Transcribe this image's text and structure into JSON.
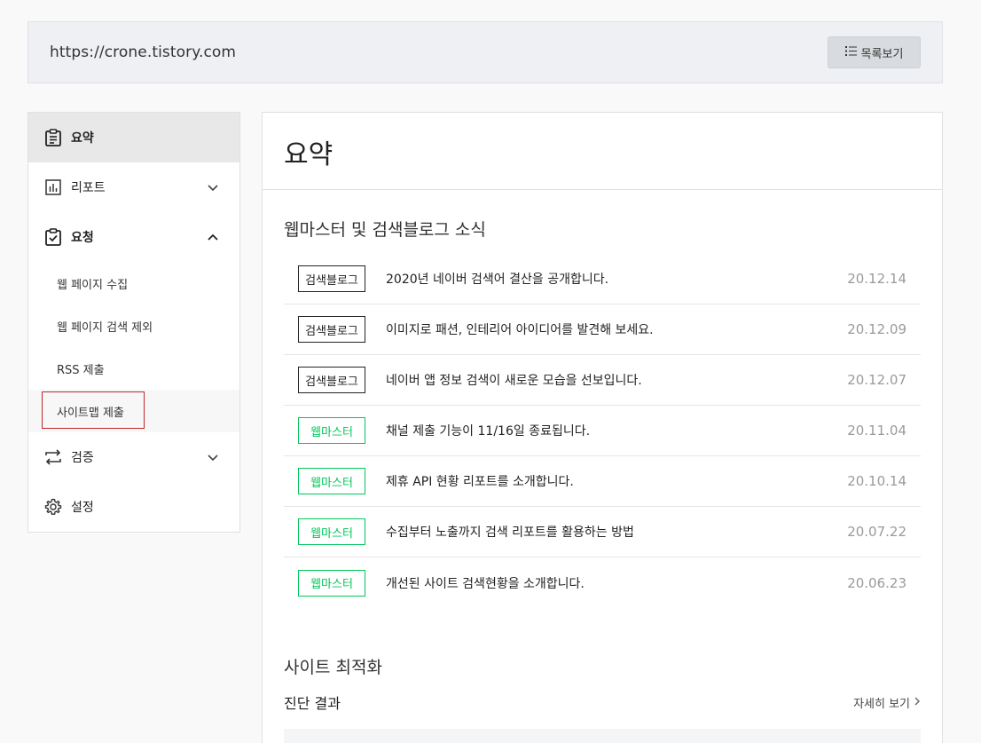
{
  "url_bar": {
    "url": "https://crone.tistory.com",
    "list_button_label": "목록보기"
  },
  "sidebar": {
    "items": [
      {
        "label": "요약",
        "icon": "clipboard-icon",
        "active": true
      },
      {
        "label": "리포트",
        "icon": "bar-chart-icon",
        "chevron": "down"
      },
      {
        "label": "요청",
        "icon": "check-clipboard-icon",
        "chevron": "up"
      }
    ],
    "sub_items": [
      "웹 페이지 수집",
      "웹 페이지 검색 제외",
      "RSS 제출",
      "사이트맵 제출"
    ],
    "bottom_items": [
      {
        "label": "검증",
        "icon": "swap-arrows-icon",
        "chevron": "down"
      },
      {
        "label": "설정",
        "icon": "gear-icon"
      }
    ]
  },
  "main": {
    "title": "요약",
    "news_section_title": "웹마스터 및 검색블로그 소식",
    "news": [
      {
        "tag": "검색블로그",
        "title": "2020년 네이버 검색어 결산을 공개합니다.",
        "date": "20.12.14"
      },
      {
        "tag": "검색블로그",
        "title": "이미지로 패션, 인테리어 아이디어를 발견해 보세요.",
        "date": "20.12.09"
      },
      {
        "tag": "검색블로그",
        "title": "네이버 앱 정보 검색이 새로운 모습을 선보입니다.",
        "date": "20.12.07"
      },
      {
        "tag": "웹마스터",
        "title": "채널 제출 기능이 11/16일 종료됩니다.",
        "date": "20.11.04"
      },
      {
        "tag": "웹마스터",
        "title": "제휴 API 현황 리포트를 소개합니다.",
        "date": "20.10.14"
      },
      {
        "tag": "웹마스터",
        "title": "수집부터 노출까지 검색 리포트를 활용하는 방법",
        "date": "20.07.22"
      },
      {
        "tag": "웹마스터",
        "title": "개선된 사이트 검색현황을 소개합니다.",
        "date": "20.06.23"
      }
    ],
    "optimization_title": "사이트 최적화",
    "diagnosis_label": "진단 결과",
    "more_label": "자세히 보기"
  },
  "colors": {
    "accent_green": "#03c75a",
    "highlight_red": "#c0272d"
  }
}
